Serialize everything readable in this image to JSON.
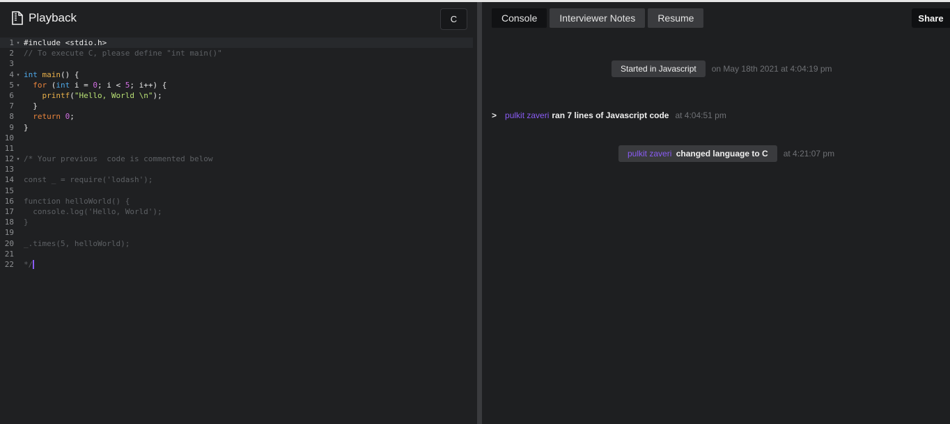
{
  "left_header": {
    "title": "Playback",
    "language_button": "C"
  },
  "editor": {
    "lines": [
      {
        "n": "1",
        "fold": true,
        "text": "#include <stdio.h>"
      },
      {
        "n": "2",
        "fold": false,
        "text": "// To execute C, please define \"int main()\""
      },
      {
        "n": "3",
        "fold": false,
        "text": ""
      },
      {
        "n": "4",
        "fold": true,
        "text": "int main() {"
      },
      {
        "n": "5",
        "fold": true,
        "text": "  for (int i = 0; i < 5; i++) {"
      },
      {
        "n": "6",
        "fold": false,
        "text": "    printf(\"Hello, World \\n\");"
      },
      {
        "n": "7",
        "fold": false,
        "text": "  }"
      },
      {
        "n": "8",
        "fold": false,
        "text": "  return 0;"
      },
      {
        "n": "9",
        "fold": false,
        "text": "}"
      },
      {
        "n": "10",
        "fold": false,
        "text": ""
      },
      {
        "n": "11",
        "fold": false,
        "text": ""
      },
      {
        "n": "12",
        "fold": true,
        "text": "/* Your previous  code is commented below"
      },
      {
        "n": "13",
        "fold": false,
        "text": ""
      },
      {
        "n": "14",
        "fold": false,
        "text": "const _ = require('lodash');"
      },
      {
        "n": "15",
        "fold": false,
        "text": ""
      },
      {
        "n": "16",
        "fold": false,
        "text": "function helloWorld() {"
      },
      {
        "n": "17",
        "fold": false,
        "text": "  console.log('Hello, World');"
      },
      {
        "n": "18",
        "fold": false,
        "text": "}"
      },
      {
        "n": "19",
        "fold": false,
        "text": ""
      },
      {
        "n": "20",
        "fold": false,
        "text": "_.times(5, helloWorld);"
      },
      {
        "n": "21",
        "fold": false,
        "text": ""
      },
      {
        "n": "22",
        "fold": false,
        "text": "*/"
      }
    ]
  },
  "right": {
    "tabs": [
      {
        "label": "Console",
        "active": true
      },
      {
        "label": "Interviewer Notes",
        "active": false
      },
      {
        "label": "Resume",
        "active": false
      }
    ],
    "share_label": "Share",
    "events": {
      "started": {
        "label": "Started in Javascript",
        "time": "on May 18th 2021 at 4:04:19 pm"
      },
      "ran": {
        "arrow": ">",
        "user": "pulkit zaveri",
        "msg": "ran 7 lines of Javascript code",
        "time": "at 4:04:51 pm"
      },
      "changed": {
        "user": "pulkit zaveri",
        "msg": "changed language to C",
        "time": "at 4:21:07 pm"
      }
    }
  },
  "colors": {
    "accent_purple": "#8a5cf5",
    "keyword": "#e9843c",
    "type": "#4ea8e8",
    "string": "#b8e074",
    "number": "#d06ee0",
    "comment": "#5d6064"
  },
  "icons": {
    "title_icon": "document-icon",
    "fold_icon": "fold-triangle-icon"
  }
}
